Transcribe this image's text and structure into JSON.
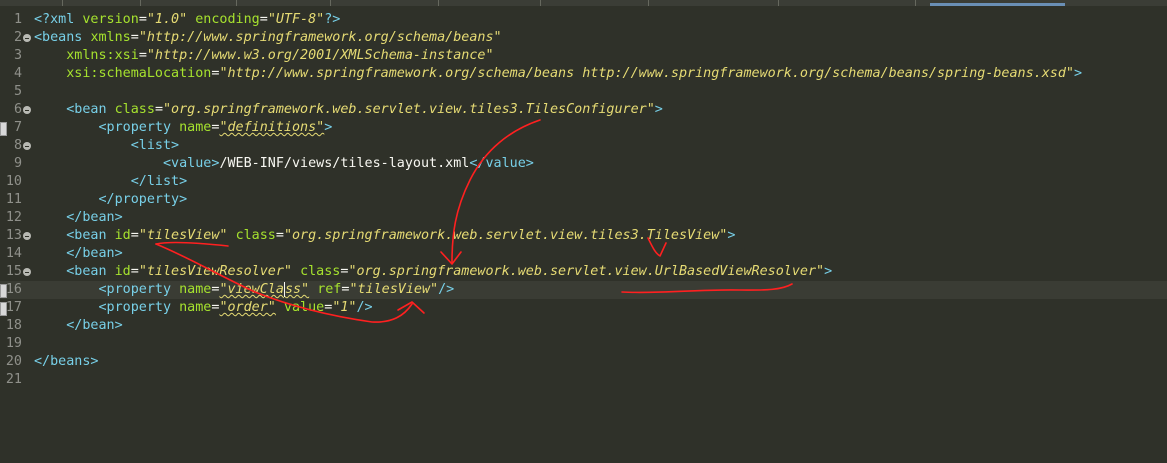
{
  "editor": {
    "lines": [
      {
        "n": "1",
        "tokens": [
          {
            "c": "tag",
            "t": "<?xml "
          },
          {
            "c": "attr",
            "t": "version"
          },
          {
            "c": "plain",
            "t": "="
          },
          {
            "c": "str",
            "t": "\"1.0\""
          },
          {
            "c": "plain",
            "t": " "
          },
          {
            "c": "attr",
            "t": "encoding"
          },
          {
            "c": "plain",
            "t": "="
          },
          {
            "c": "str",
            "t": "\"UTF-8\""
          },
          {
            "c": "tag",
            "t": "?>"
          }
        ]
      },
      {
        "n": "2",
        "fold": true,
        "tokens": [
          {
            "c": "tag",
            "t": "<beans "
          },
          {
            "c": "attr",
            "t": "xmlns"
          },
          {
            "c": "plain",
            "t": "="
          },
          {
            "c": "str",
            "t": "\"http://www.springframework.org/schema/beans\""
          }
        ]
      },
      {
        "n": "3",
        "tokens": [
          {
            "c": "plain",
            "t": "    "
          },
          {
            "c": "attr",
            "t": "xmlns:xsi"
          },
          {
            "c": "plain",
            "t": "="
          },
          {
            "c": "str",
            "t": "\"http://www.w3.org/2001/XMLSchema-instance\""
          }
        ]
      },
      {
        "n": "4",
        "tokens": [
          {
            "c": "plain",
            "t": "    "
          },
          {
            "c": "attr",
            "t": "xsi:schemaLocation"
          },
          {
            "c": "plain",
            "t": "="
          },
          {
            "c": "str",
            "t": "\"http://www.springframework.org/schema/beans http://www.springframework.org/schema/beans/spring-beans.xsd\""
          },
          {
            "c": "tag",
            "t": ">"
          }
        ]
      },
      {
        "n": "5",
        "tokens": []
      },
      {
        "n": "6",
        "fold": true,
        "tokens": [
          {
            "c": "plain",
            "t": "    "
          },
          {
            "c": "tag",
            "t": "<bean "
          },
          {
            "c": "attr",
            "t": "class"
          },
          {
            "c": "plain",
            "t": "="
          },
          {
            "c": "str",
            "t": "\"org.springframework.web.servlet.view.tiles3.TilesConfigurer\""
          },
          {
            "c": "tag",
            "t": ">"
          }
        ]
      },
      {
        "n": "7",
        "mark": true,
        "tokens": [
          {
            "c": "plain",
            "t": "        "
          },
          {
            "c": "tag",
            "t": "<property "
          },
          {
            "c": "attr",
            "t": "name"
          },
          {
            "c": "plain",
            "t": "="
          },
          {
            "c": "str sq",
            "t": "\"definitions\""
          },
          {
            "c": "tag",
            "t": ">"
          }
        ]
      },
      {
        "n": "8",
        "fold": true,
        "tokens": [
          {
            "c": "plain",
            "t": "            "
          },
          {
            "c": "tag",
            "t": "<list>"
          }
        ]
      },
      {
        "n": "9",
        "tokens": [
          {
            "c": "plain",
            "t": "                "
          },
          {
            "c": "tag",
            "t": "<value>"
          },
          {
            "c": "plain",
            "t": "/WEB-INF/views/tiles-layout.xml"
          },
          {
            "c": "tag",
            "t": "</value>"
          }
        ]
      },
      {
        "n": "10",
        "tokens": [
          {
            "c": "plain",
            "t": "            "
          },
          {
            "c": "tag",
            "t": "</list>"
          }
        ]
      },
      {
        "n": "11",
        "tokens": [
          {
            "c": "plain",
            "t": "        "
          },
          {
            "c": "tag",
            "t": "</property>"
          }
        ]
      },
      {
        "n": "12",
        "tokens": [
          {
            "c": "plain",
            "t": "    "
          },
          {
            "c": "tag",
            "t": "</bean>"
          }
        ]
      },
      {
        "n": "13",
        "fold": true,
        "tokens": [
          {
            "c": "plain",
            "t": "    "
          },
          {
            "c": "tag",
            "t": "<bean "
          },
          {
            "c": "attr",
            "t": "id"
          },
          {
            "c": "plain",
            "t": "="
          },
          {
            "c": "str",
            "t": "\"tilesView\""
          },
          {
            "c": "plain",
            "t": " "
          },
          {
            "c": "attr",
            "t": "class"
          },
          {
            "c": "plain",
            "t": "="
          },
          {
            "c": "str",
            "t": "\"org.springframework.web.servlet.view.tiles3.TilesView\""
          },
          {
            "c": "tag",
            "t": ">"
          }
        ]
      },
      {
        "n": "14",
        "tokens": [
          {
            "c": "plain",
            "t": "    "
          },
          {
            "c": "tag",
            "t": "</bean>"
          }
        ]
      },
      {
        "n": "15",
        "fold": true,
        "tokens": [
          {
            "c": "plain",
            "t": "    "
          },
          {
            "c": "tag",
            "t": "<bean "
          },
          {
            "c": "attr",
            "t": "id"
          },
          {
            "c": "plain",
            "t": "="
          },
          {
            "c": "str",
            "t": "\"tilesViewResolver\""
          },
          {
            "c": "plain",
            "t": " "
          },
          {
            "c": "attr",
            "t": "class"
          },
          {
            "c": "plain",
            "t": "="
          },
          {
            "c": "str",
            "t": "\"org.springframework.web.servlet.view.UrlBasedViewResolver\""
          },
          {
            "c": "tag",
            "t": ">"
          }
        ]
      },
      {
        "n": "16",
        "mark": true,
        "current": true,
        "tokens": [
          {
            "c": "plain",
            "t": "        "
          },
          {
            "c": "tag",
            "t": "<property "
          },
          {
            "c": "attr",
            "t": "name"
          },
          {
            "c": "plain",
            "t": "="
          },
          {
            "c": "str sq",
            "t": "\"viewCla"
          },
          {
            "c": "caret",
            "t": ""
          },
          {
            "c": "str sq",
            "t": "ss\""
          },
          {
            "c": "plain",
            "t": " "
          },
          {
            "c": "attr",
            "t": "ref"
          },
          {
            "c": "plain",
            "t": "="
          },
          {
            "c": "str",
            "t": "\"tilesView\""
          },
          {
            "c": "tag",
            "t": "/>"
          }
        ]
      },
      {
        "n": "17",
        "mark": true,
        "tokens": [
          {
            "c": "plain",
            "t": "        "
          },
          {
            "c": "tag",
            "t": "<property "
          },
          {
            "c": "attr",
            "t": "name"
          },
          {
            "c": "plain",
            "t": "="
          },
          {
            "c": "str sq",
            "t": "\"order\""
          },
          {
            "c": "plain",
            "t": " "
          },
          {
            "c": "attr",
            "t": "value"
          },
          {
            "c": "plain",
            "t": "="
          },
          {
            "c": "str",
            "t": "\"1\""
          },
          {
            "c": "tag",
            "t": "/>"
          }
        ]
      },
      {
        "n": "18",
        "tokens": [
          {
            "c": "plain",
            "t": "    "
          },
          {
            "c": "tag",
            "t": "</bean>"
          }
        ]
      },
      {
        "n": "19",
        "tokens": []
      },
      {
        "n": "20",
        "tokens": [
          {
            "c": "tag",
            "t": "</beans>"
          }
        ]
      },
      {
        "n": "21",
        "tokens": []
      }
    ]
  },
  "annotation_color": "#ff2020"
}
